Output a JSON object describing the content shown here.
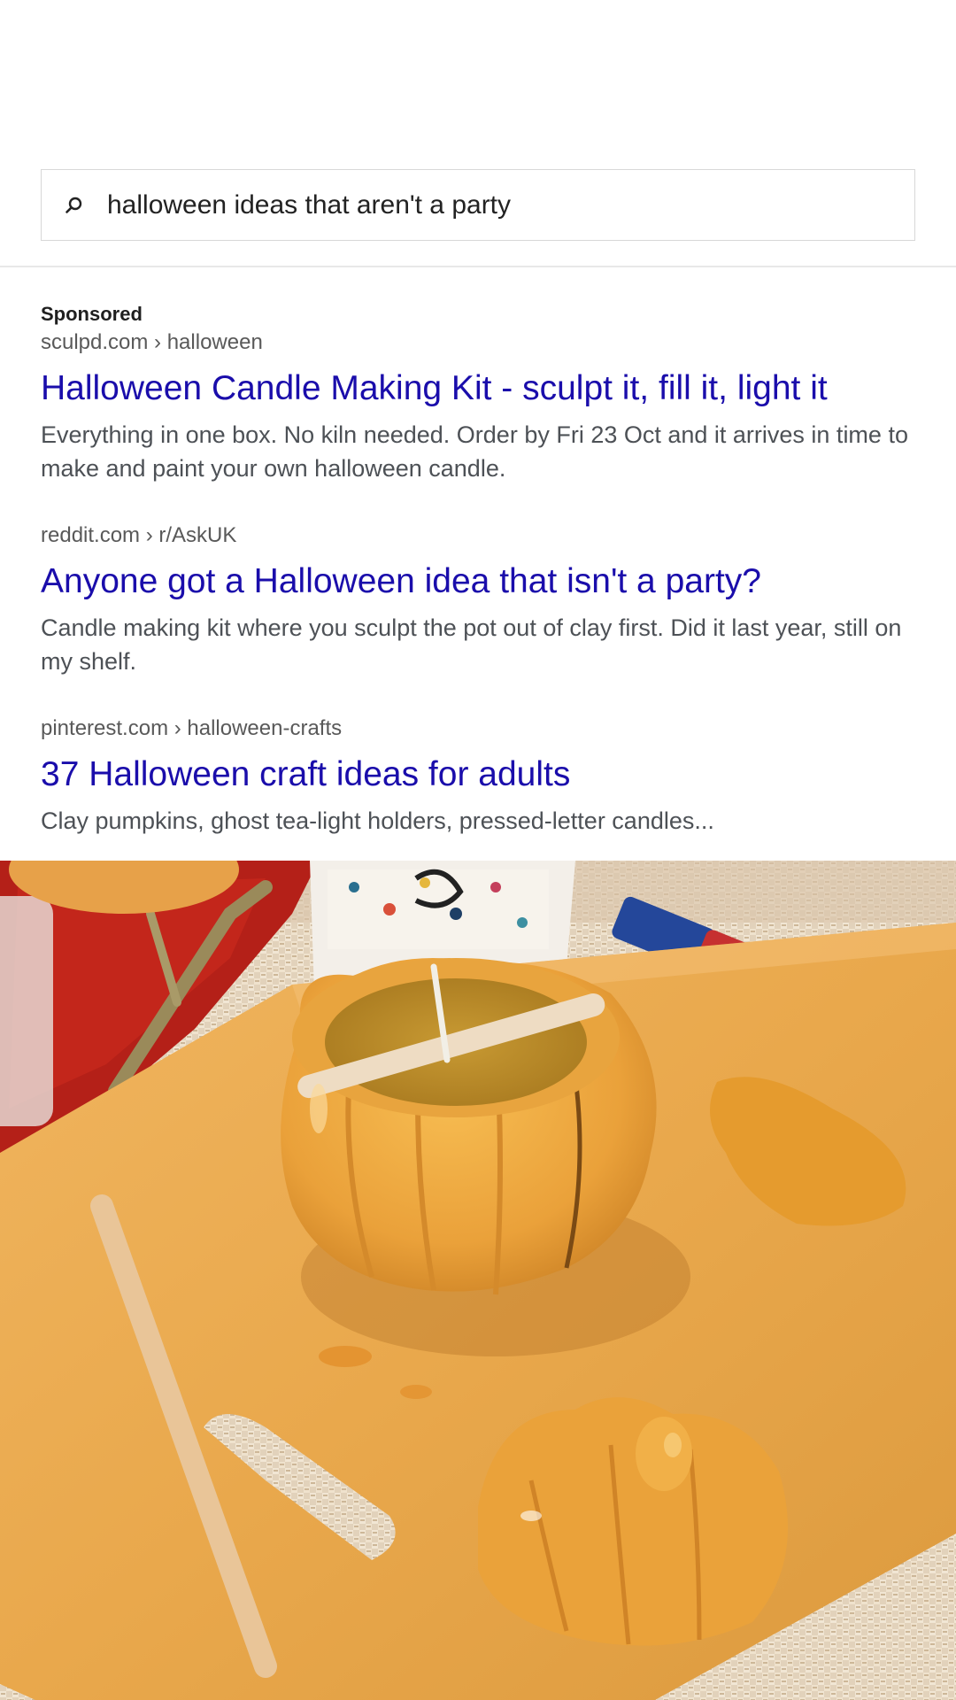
{
  "search": {
    "query": "halloween ideas that aren't a party"
  },
  "results": [
    {
      "sponsored_label": "Sponsored",
      "url": "sculpd.com › halloween",
      "title": "Halloween Candle Making Kit - sculpt it, fill it, light it",
      "snippet": "Everything in one box. No kiln needed. Order by Fri 23 Oct and it arrives in time to make and paint your own halloween candle."
    },
    {
      "url": "reddit.com › r/AskUK",
      "title": "Anyone got a Halloween idea that isn't a party?",
      "snippet": "Candle making kit where you sculpt the pot out of clay first. Did it last year, still on my shelf."
    },
    {
      "url": "pinterest.com › halloween-crafts",
      "title": "37 Halloween craft ideas for adults",
      "snippet": "Clay pumpkins, ghost tea-light holders, pressed-letter candles..."
    }
  ],
  "colors": {
    "link": "#1a0dab",
    "url_text": "#595959",
    "snippet_text": "#4d5156"
  }
}
